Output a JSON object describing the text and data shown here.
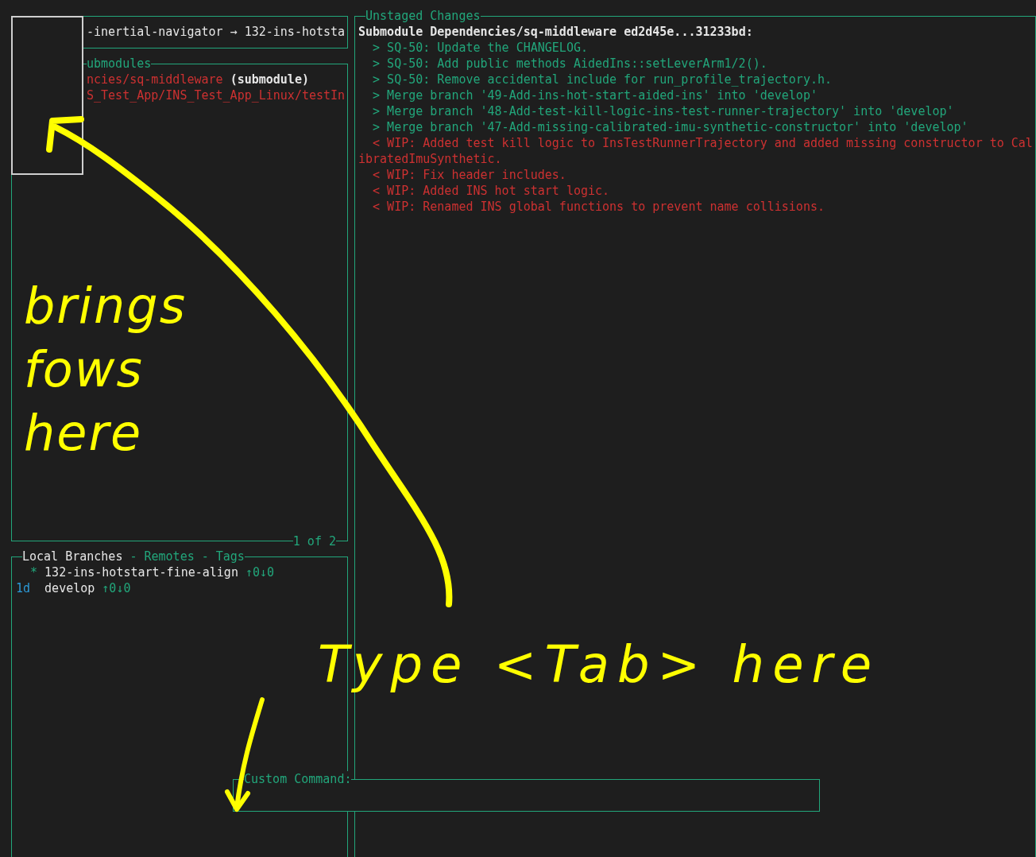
{
  "status_panel": {
    "text": "-inertial-navigator → 132-ins-hotsta"
  },
  "files_panel": {
    "title": "ubmodules",
    "footer": "1 of 2",
    "items": [
      {
        "path": "ncies/sq-middleware",
        "suffix": "(submodule)"
      },
      {
        "path": "S_Test_App/INS_Test_App_Linux/testIn"
      }
    ]
  },
  "branches_panel": {
    "tabs": [
      {
        "label": "Local Branches",
        "selected": true
      },
      {
        "label": "Remotes",
        "selected": false
      },
      {
        "label": "Tags",
        "selected": false
      }
    ],
    "separators": [
      "-",
      "-"
    ],
    "branches": [
      {
        "marker": "*",
        "name": "132-ins-hotstart-fine-align",
        "sync": "↑0↓0"
      },
      {
        "age": "1d",
        "name": "develop",
        "sync": "↑0↓0"
      }
    ]
  },
  "diff_panel": {
    "title": "Unstaged Changes",
    "header": "Submodule Dependencies/sq-middleware ed2d45e...31233bd:",
    "lines": [
      {
        "kind": "added",
        "text": "> SQ-50: Update the CHANGELOG."
      },
      {
        "kind": "added",
        "text": "> SQ-50: Add public methods AidedIns::setLeverArm1/2()."
      },
      {
        "kind": "added",
        "text": "> SQ-50: Remove accidental include for run_profile_trajectory.h."
      },
      {
        "kind": "added",
        "text": "> Merge branch '49-Add-ins-hot-start-aided-ins' into 'develop'"
      },
      {
        "kind": "added",
        "text": "> Merge branch '48-Add-test-kill-logic-ins-test-runner-trajectory' into 'develop'"
      },
      {
        "kind": "added",
        "text": "> Merge branch '47-Add-missing-calibrated-imu-synthetic-constructor' into 'develop'"
      },
      {
        "kind": "removed",
        "text": "< WIP: Added test kill logic to InsTestRunnerTrajectory and added missing constructor to CalibratedImuSynthetic."
      },
      {
        "kind": "removed",
        "text": "< WIP: Fix header includes."
      },
      {
        "kind": "removed",
        "text": "< WIP: Added INS hot start logic."
      },
      {
        "kind": "removed",
        "text": "< WIP: Renamed INS global functions to prevent name collisions."
      }
    ]
  },
  "custom_command": {
    "label": "Custom Command:"
  },
  "annotations": [
    {
      "lines": [
        "brings",
        "fows",
        "here"
      ]
    },
    {
      "lines": [
        "Type <Tab> here"
      ]
    }
  ]
}
